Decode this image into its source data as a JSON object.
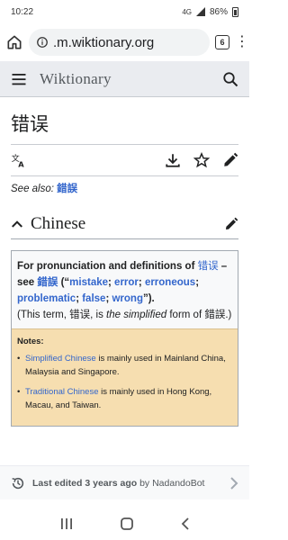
{
  "status": {
    "time": "10:22",
    "battery": "86%",
    "signal": "4G"
  },
  "browser": {
    "url": ".m.wiktionary.org",
    "tab_count": "6"
  },
  "wiki": {
    "brand": "Wiktionary"
  },
  "page": {
    "title": "错误",
    "see_also_label": "See also:",
    "see_also_link": "錯誤"
  },
  "section": {
    "title": "Chinese"
  },
  "infobox": {
    "line1_pre": "For pronunciation and definitions of ",
    "term": "错误",
    "line1_post": " – see ",
    "trad_link": "錯誤",
    "open": " (“",
    "gloss1": "mistake",
    "sep1": "; ",
    "gloss2": "error",
    "sep2": "; ",
    "gloss3": "erroneous",
    "sep3": "; ",
    "gloss4": "problematic",
    "sep4": "; ",
    "gloss5": "false",
    "sep5": "; ",
    "gloss6": "wrong",
    "close": "”).",
    "note_pre": "(This term, 错误, is ",
    "note_em": "the simplified",
    "note_post": " form of 錯誤.)",
    "notes_heading": "Notes:",
    "note1_link": "Simplified Chinese",
    "note1_text": " is mainly used in Mainland China, Malaysia and Singapore.",
    "note2_link": "Traditional Chinese",
    "note2_text": " is mainly used in Hong Kong, Macau, and Taiwan."
  },
  "footer": {
    "prefix": "Last edited ",
    "age": "3 years ago",
    "by": " by ",
    "user": "NadandoBot"
  },
  "colors": {
    "link": "#3366cc",
    "notes_bg": "#f6deb0",
    "header_bg": "#eaecf0"
  }
}
